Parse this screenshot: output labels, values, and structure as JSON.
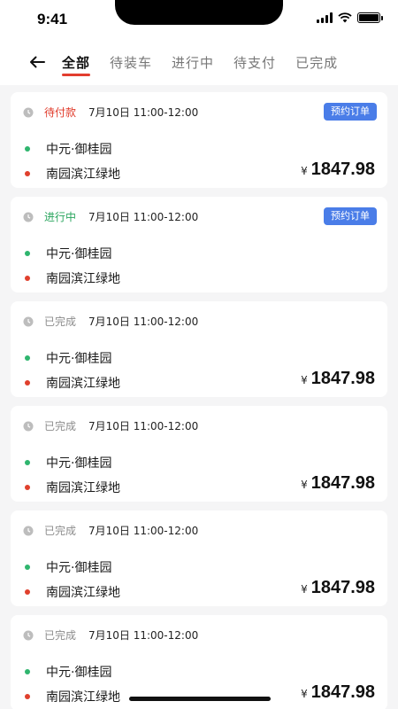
{
  "status_bar": {
    "time": "9:41"
  },
  "tabs": [
    {
      "label": "全部",
      "active": true
    },
    {
      "label": "待装车",
      "active": false
    },
    {
      "label": "进行中",
      "active": false
    },
    {
      "label": "待支付",
      "active": false
    },
    {
      "label": "已完成",
      "active": false
    }
  ],
  "orders": [
    {
      "status": "待付款",
      "status_color": "red",
      "datetime": "7月10日 11:00-12:00",
      "badge": "预约订单",
      "from": "中元·御桂园",
      "to": "南园滨江绿地",
      "currency": "¥",
      "price": "1847.98"
    },
    {
      "status": "进行中",
      "status_color": "green",
      "datetime": "7月10日 11:00-12:00",
      "badge": "预约订单",
      "from": "中元·御桂园",
      "to": "南园滨江绿地",
      "currency": "",
      "price": ""
    },
    {
      "status": "已完成",
      "status_color": "gray",
      "datetime": "7月10日 11:00-12:00",
      "badge": "",
      "from": "中元·御桂园",
      "to": "南园滨江绿地",
      "currency": "¥",
      "price": "1847.98"
    },
    {
      "status": "已完成",
      "status_color": "gray",
      "datetime": "7月10日 11:00-12:00",
      "badge": "",
      "from": "中元·御桂园",
      "to": "南园滨江绿地",
      "currency": "¥",
      "price": "1847.98"
    },
    {
      "status": "已完成",
      "status_color": "gray",
      "datetime": "7月10日 11:00-12:00",
      "badge": "",
      "from": "中元·御桂园",
      "to": "南园滨江绿地",
      "currency": "¥",
      "price": "1847.98"
    },
    {
      "status": "已完成",
      "status_color": "gray",
      "datetime": "7月10日 11:00-12:00",
      "badge": "",
      "from": "中元·御桂园",
      "to": "南园滨江绿地",
      "currency": "¥",
      "price": "1847.98"
    }
  ],
  "colors": {
    "accent_red": "#e23d2e",
    "badge_blue": "#4a7de8",
    "status_green": "#2aa55e"
  }
}
